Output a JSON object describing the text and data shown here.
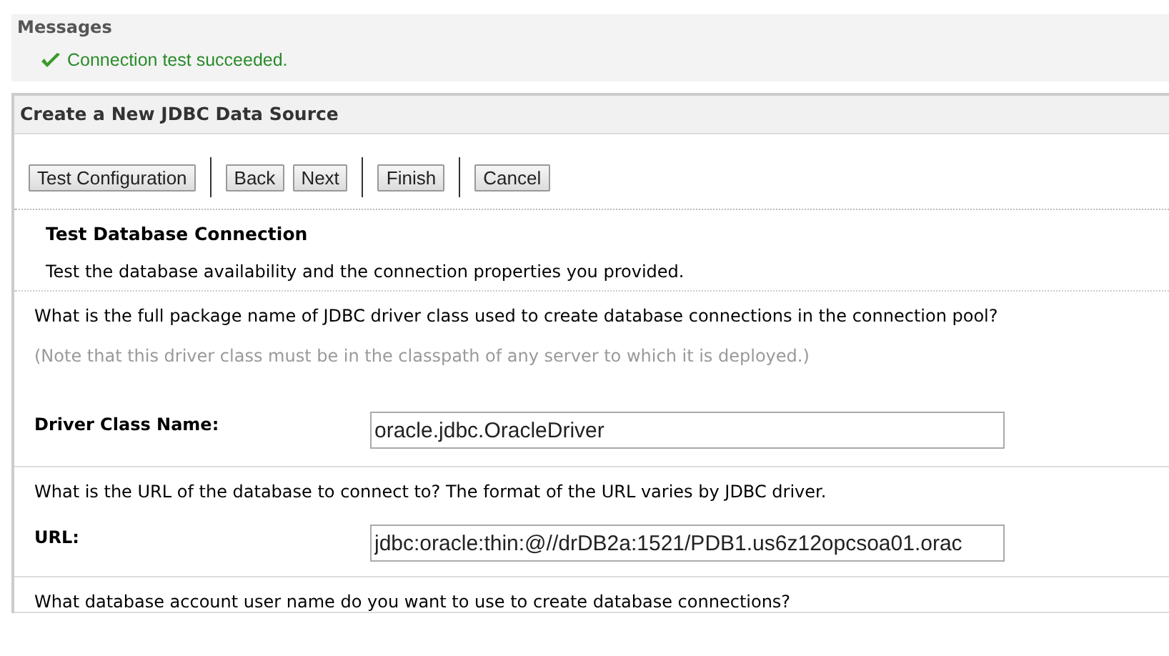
{
  "messages": {
    "title": "Messages",
    "items": [
      {
        "kind": "success",
        "text": "Connection test succeeded."
      }
    ]
  },
  "panel": {
    "title": "Create a New JDBC Data Source",
    "button_groups": [
      [
        "Test Configuration"
      ],
      [
        "Back",
        "Next"
      ],
      [
        "Finish"
      ],
      [
        "Cancel"
      ]
    ],
    "section": {
      "title": "Test Database Connection",
      "description": "Test the database availability and the connection properties you provided."
    },
    "fields": [
      {
        "question": "What is the full package name of JDBC driver class used to create database connections in the connection pool?",
        "note": "(Note that this driver class must be in the classpath of any server to which it is deployed.)",
        "label": "Driver Class Name:",
        "value": "oracle.jdbc.OracleDriver"
      },
      {
        "question": "What is the URL of the database to connect to? The format of the URL varies by JDBC driver.",
        "label": "URL:",
        "value": "jdbc:oracle:thin:@//drDB2a:1521/PDB1.us6z12opcsoa01.orac"
      },
      {
        "question": "What database account user name do you want to use to create database connections?"
      }
    ]
  }
}
